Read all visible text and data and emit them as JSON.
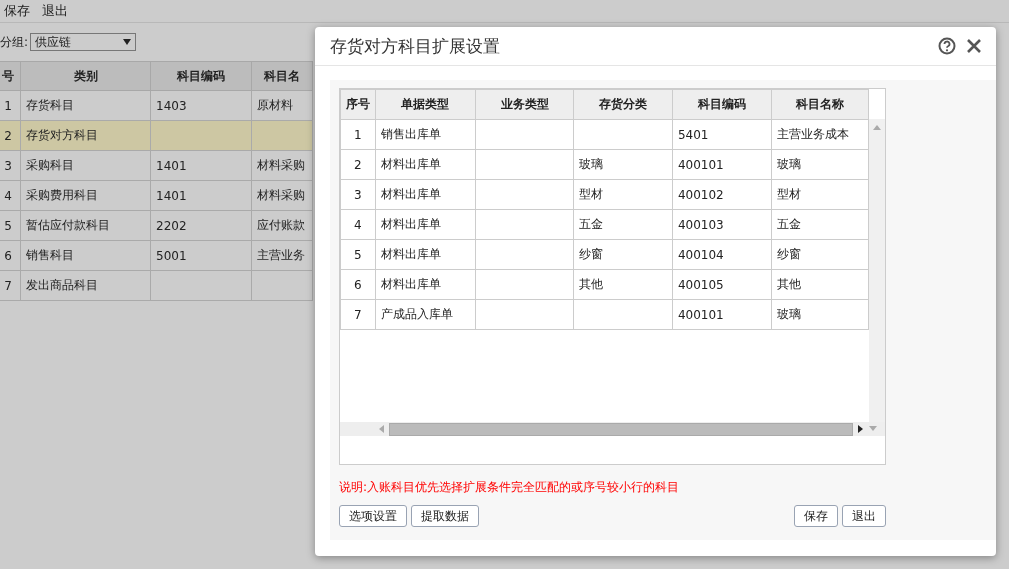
{
  "menu": [
    "保存",
    "退出"
  ],
  "group": {
    "label": "分组:",
    "value": "供应链"
  },
  "main_table": {
    "columns": [
      "号",
      "类别",
      "科目编码",
      "科目名"
    ],
    "rows": [
      {
        "cells": [
          "1",
          "存货科目",
          "1403",
          "原材料"
        ],
        "selected": false
      },
      {
        "cells": [
          "2",
          "存货对方科目",
          "",
          ""
        ],
        "selected": true
      },
      {
        "cells": [
          "3",
          "采购科目",
          "1401",
          "材料采购"
        ],
        "selected": false
      },
      {
        "cells": [
          "4",
          "采购费用科目",
          "1401",
          "材料采购"
        ],
        "selected": false
      },
      {
        "cells": [
          "5",
          "暂估应付款科目",
          "2202",
          "应付账款"
        ],
        "selected": false
      },
      {
        "cells": [
          "6",
          "销售科目",
          "5001",
          "主营业务"
        ],
        "selected": false
      },
      {
        "cells": [
          "7",
          "发出商品科目",
          "",
          ""
        ],
        "selected": false
      }
    ]
  },
  "dialog": {
    "title": "存货对方科目扩展设置",
    "table": {
      "columns": [
        "序号",
        "单据类型",
        "业务类型",
        "存货分类",
        "科目编码",
        "科目名称"
      ],
      "rows": [
        [
          "1",
          "销售出库单",
          "",
          "",
          "5401",
          "主营业务成本"
        ],
        [
          "2",
          "材料出库单",
          "",
          "玻璃",
          "400101",
          "玻璃"
        ],
        [
          "3",
          "材料出库单",
          "",
          "型材",
          "400102",
          "型材"
        ],
        [
          "4",
          "材料出库单",
          "",
          "五金",
          "400103",
          "五金"
        ],
        [
          "5",
          "材料出库单",
          "",
          "纱窗",
          "400104",
          "纱窗"
        ],
        [
          "6",
          "材料出库单",
          "",
          "其他",
          "400105",
          "其他"
        ],
        [
          "7",
          "产成品入库单",
          "",
          "",
          "400101",
          "玻璃"
        ]
      ]
    },
    "note": "说明:入账科目优先选择扩展条件完全匹配的或序号较小行的科目",
    "left_buttons": [
      "选项设置",
      "提取数据"
    ],
    "right_buttons": [
      "保存",
      "退出"
    ]
  }
}
